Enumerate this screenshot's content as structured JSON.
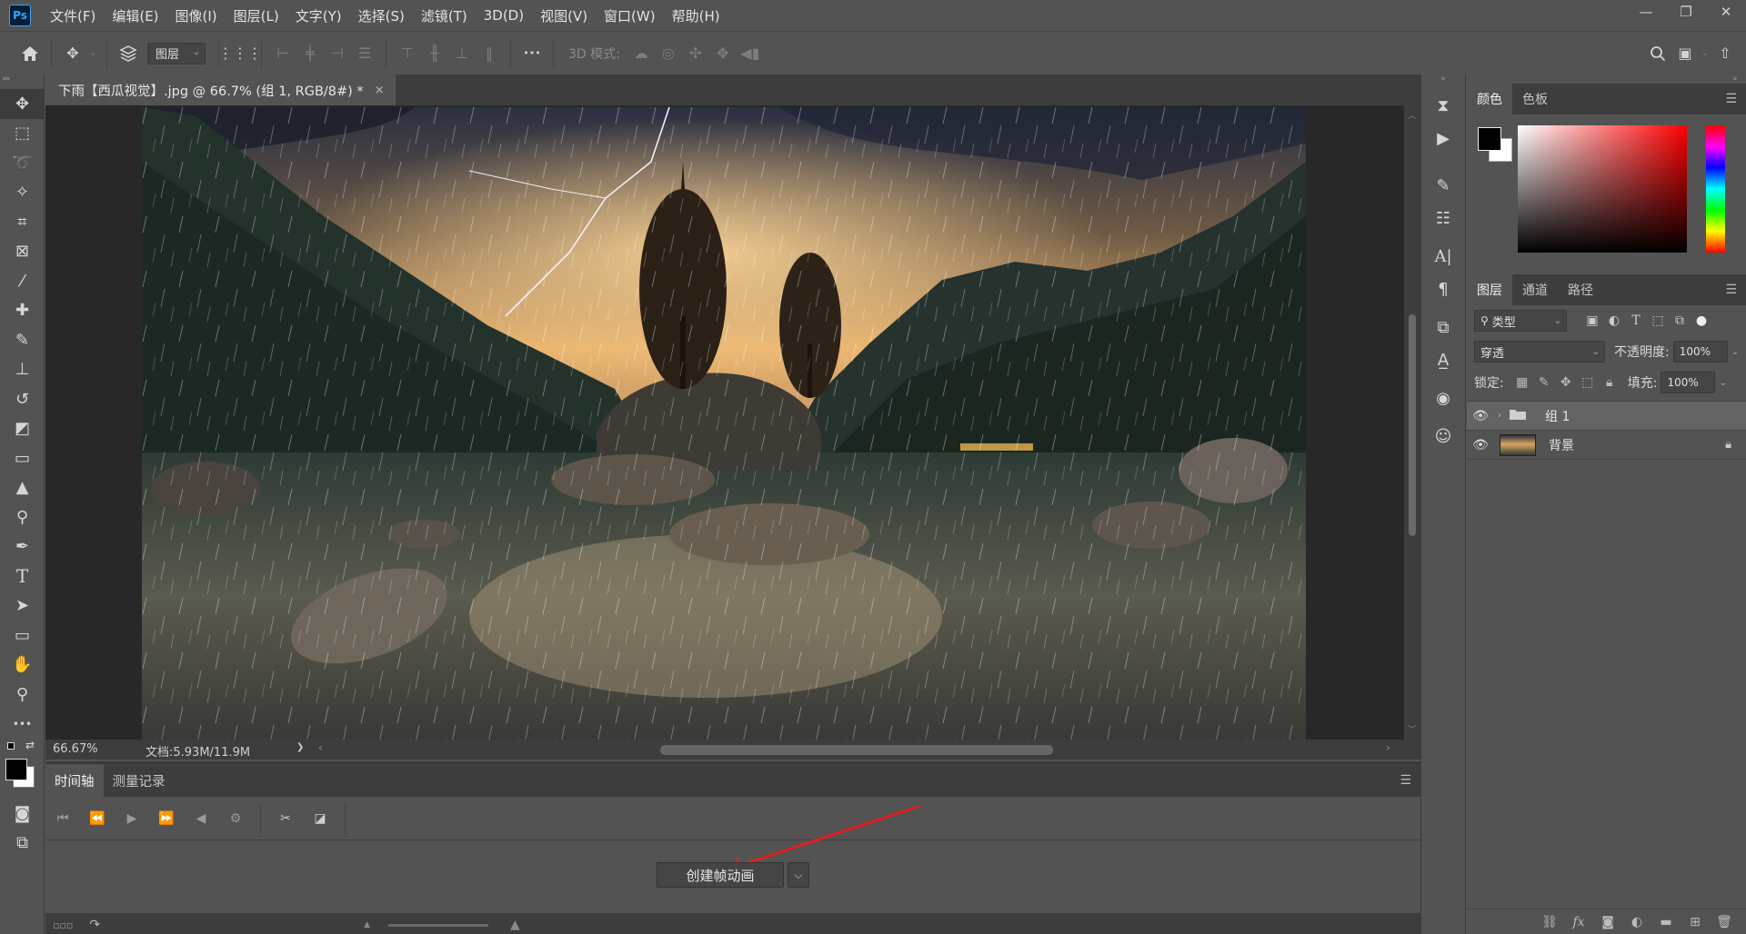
{
  "app": {
    "logo_text": "Ps"
  },
  "menu": [
    "文件(F)",
    "编辑(E)",
    "图像(I)",
    "图层(L)",
    "文字(Y)",
    "选择(S)",
    "滤镜(T)",
    "3D(D)",
    "视图(V)",
    "窗口(W)",
    "帮助(H)"
  ],
  "window_controls": {
    "minimize": "—",
    "restore": "❐",
    "close": "✕"
  },
  "options": {
    "layer_select_value": "图层",
    "mode_3d_label": "3D 模式:",
    "more_glyph": "•••"
  },
  "document": {
    "tab_title": "下雨【西瓜视觉】.jpg @ 66.7% (组 1, RGB/8#) *",
    "close_glyph": "×"
  },
  "status": {
    "zoom": "66.67%",
    "doc_size": "文档:5.93M/11.9M",
    "arrow": "❯"
  },
  "timeline": {
    "tabs": [
      "时间轴",
      "测量记录"
    ],
    "create_frame_label": "创建帧动画",
    "dropdown_glyph": "⌵"
  },
  "color_panel": {
    "tabs": [
      "颜色",
      "色板"
    ],
    "fg_color": "#000000",
    "bg_color": "#ffffff"
  },
  "layers_panel": {
    "tabs": [
      "图层",
      "通道",
      "路径"
    ],
    "filter_label": "类型",
    "blend_mode": "穿透",
    "opacity_label": "不透明度:",
    "opacity_value": "100%",
    "lock_label": "锁定:",
    "fill_label": "填充:",
    "fill_value": "100%",
    "layers": [
      {
        "name": "组 1",
        "type": "group",
        "selected": true
      },
      {
        "name": "背景",
        "type": "image",
        "locked": true
      }
    ],
    "footer_fx": "fx"
  }
}
